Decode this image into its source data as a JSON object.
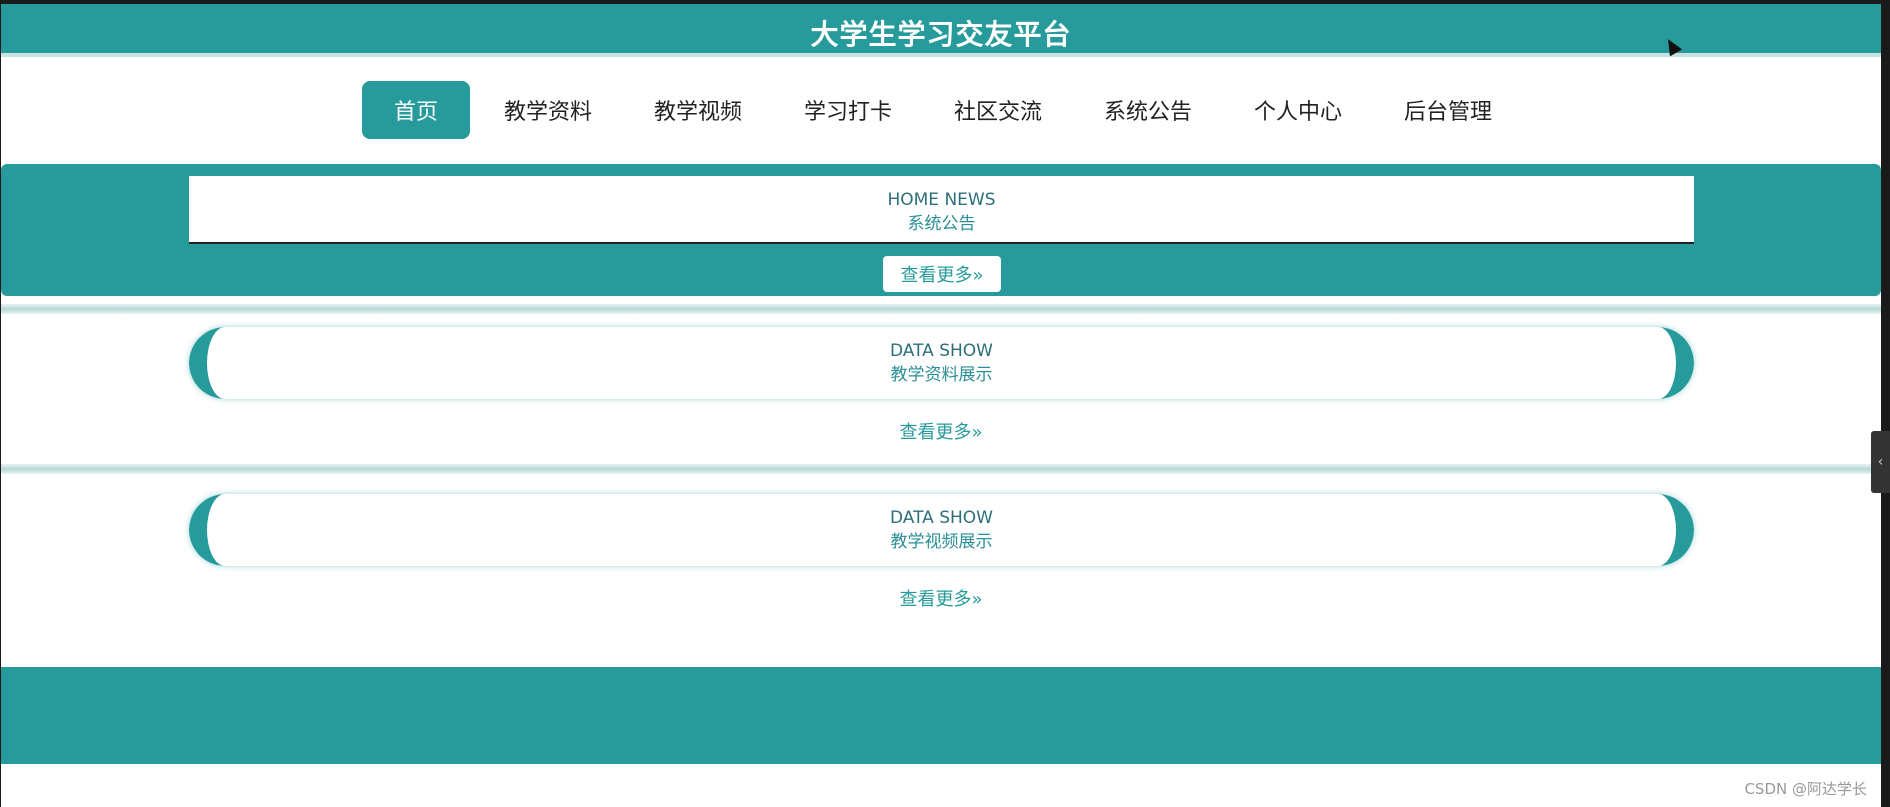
{
  "header": {
    "site_title": "大学生学习交友平台"
  },
  "nav": {
    "items": [
      {
        "label": "首页",
        "active": true
      },
      {
        "label": "教学资料",
        "active": false
      },
      {
        "label": "教学视频",
        "active": false
      },
      {
        "label": "学习打卡",
        "active": false
      },
      {
        "label": "社区交流",
        "active": false
      },
      {
        "label": "系统公告",
        "active": false
      },
      {
        "label": "个人中心",
        "active": false
      },
      {
        "label": "后台管理",
        "active": false
      }
    ]
  },
  "news_section": {
    "title_en": "HOME NEWS",
    "title_cn": "系统公告",
    "more_label": "查看更多»"
  },
  "materials_section": {
    "title_en": "DATA SHOW",
    "title_cn": "教学资料展示",
    "more_label": "查看更多»"
  },
  "videos_section": {
    "title_en": "DATA SHOW",
    "title_cn": "教学视频展示",
    "more_label": "查看更多»"
  },
  "watermark": "CSDN @阿达学长",
  "colors": {
    "accent": "#279b9b",
    "background": "#ffffff"
  },
  "icons": {
    "cursor": "mouse-cursor-icon",
    "side_handle": "chevron-left-icon"
  }
}
